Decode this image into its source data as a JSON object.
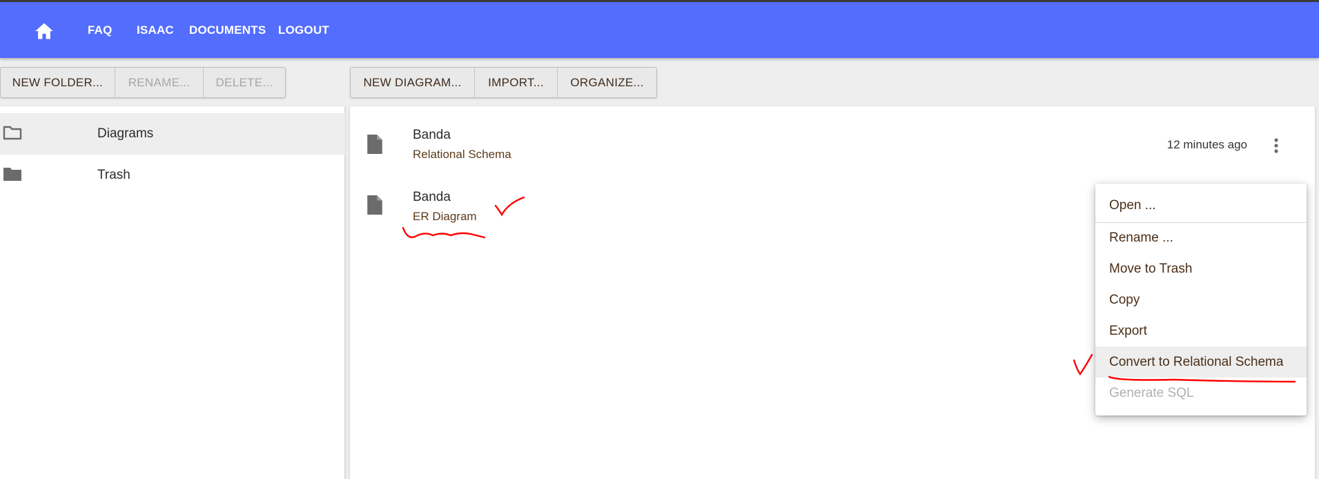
{
  "nav": {
    "home_icon": "home-icon",
    "links": [
      "FAQ",
      "ISAAC",
      "DOCUMENTS",
      "LOGOUT"
    ]
  },
  "folder_toolbar": {
    "new_folder": "NEW FOLDER...",
    "rename": "RENAME...",
    "delete": "DELETE..."
  },
  "doc_toolbar": {
    "new_diagram": "NEW DIAGRAM...",
    "import": "IMPORT...",
    "organize": "ORGANIZE..."
  },
  "folders": [
    {
      "label": "Diagrams",
      "icon": "folder-outline-icon",
      "selected": true
    },
    {
      "label": "Trash",
      "icon": "folder-icon",
      "selected": false
    }
  ],
  "documents": [
    {
      "title": "Banda",
      "type": "Relational Schema",
      "modified": "12 minutes ago",
      "icon": "file-icon"
    },
    {
      "title": "Banda",
      "type": "ER Diagram",
      "icon": "file-icon"
    }
  ],
  "context_menu": {
    "items": [
      "Open ...",
      "Rename ...",
      "Move to Trash",
      "Copy",
      "Export",
      "Convert to Relational Schema",
      "Generate SQL"
    ],
    "highlighted": "Convert to Relational Schema",
    "disabled": [
      "Generate SQL"
    ]
  },
  "colors": {
    "app_bar": "#536dfe",
    "annotation": "#ff0000"
  }
}
